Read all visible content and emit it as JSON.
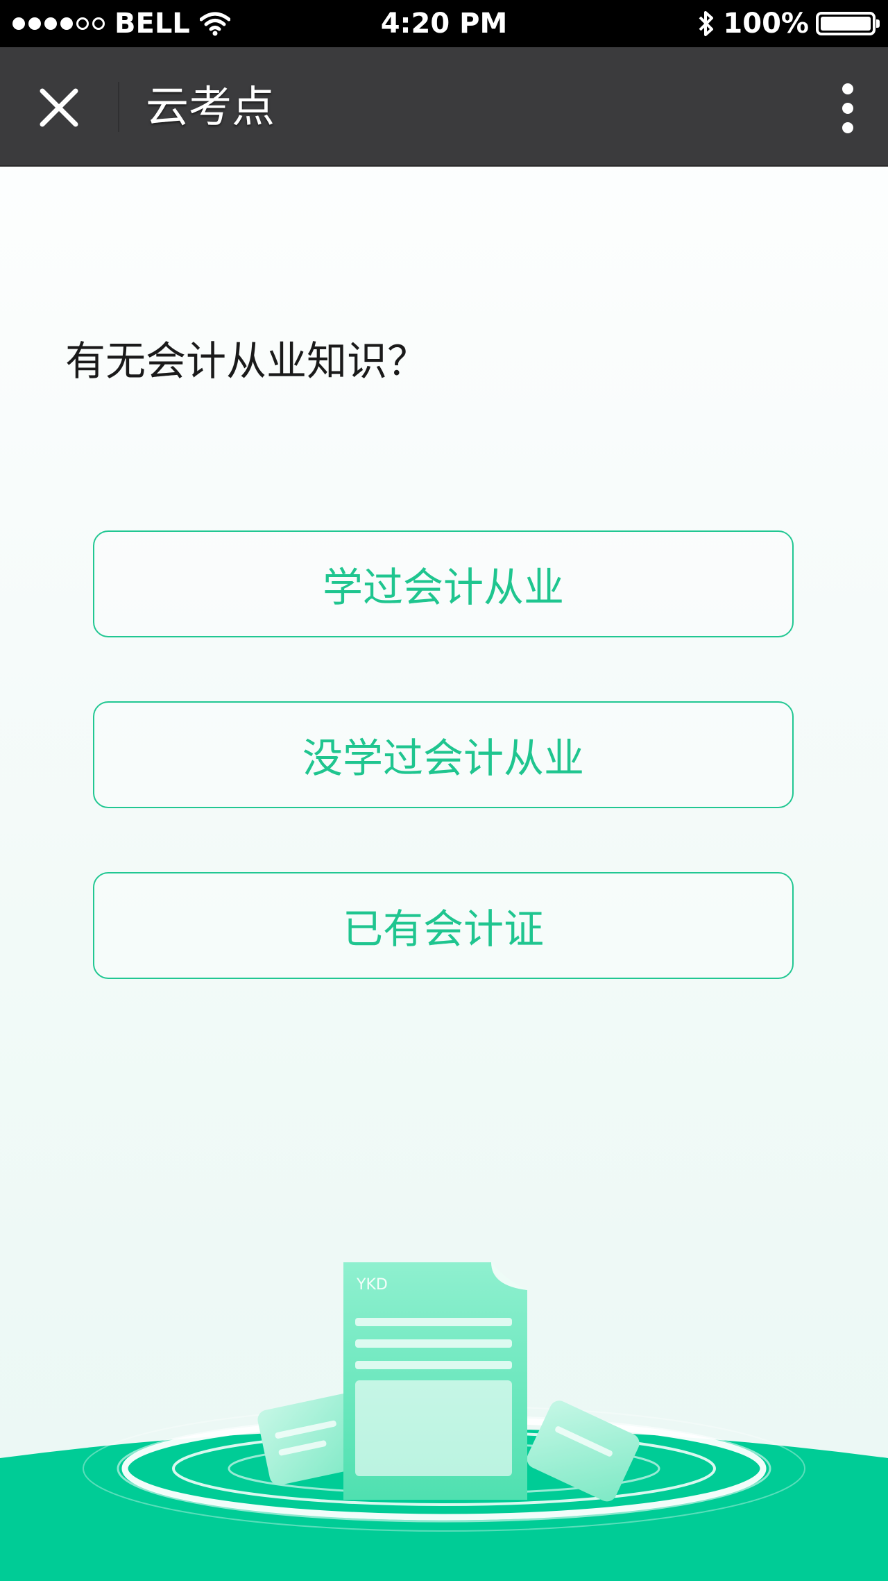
{
  "status_bar": {
    "carrier": "BELL",
    "time": "4:20 PM",
    "battery": "100%",
    "signal_filled": 4,
    "signal_total": 6
  },
  "nav": {
    "title": "云考点",
    "close_icon": "close-icon",
    "more_icon": "more-vertical-icon"
  },
  "main": {
    "question": "有无会计从业知识？",
    "options": [
      {
        "label": "学过会计从业"
      },
      {
        "label": "没学过会计从业"
      },
      {
        "label": "已有会计证"
      }
    ]
  },
  "illustration": {
    "doc_label": "YKD"
  },
  "colors": {
    "accent": "#1fc58f",
    "floor": "#00cc96",
    "nav_bg": "#3b3b3d"
  }
}
